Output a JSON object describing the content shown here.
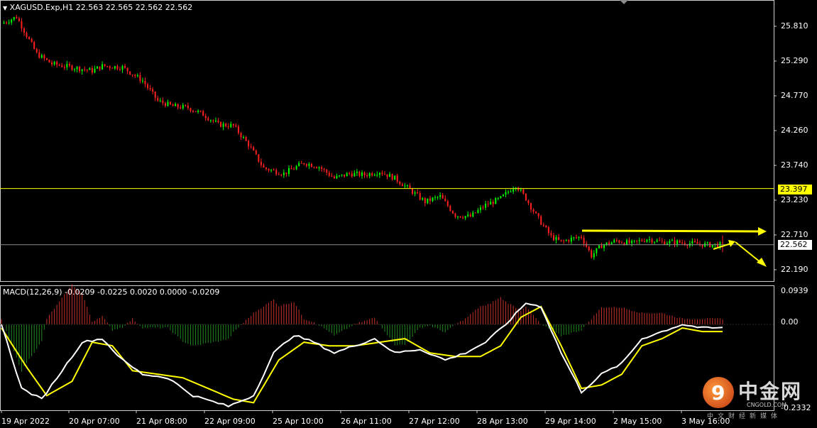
{
  "header": {
    "symbol_line": "XAGUSD.Exp,H1  22.563 22.565 22.562 22.562"
  },
  "macd": {
    "title": "MACD(12,26,9) -0.0209 -0.0225 0.0020 0.0000 -0.0209"
  },
  "price_axis": [
    "25.810",
    "25.290",
    "24.770",
    "24.260",
    "23.740",
    "23.230",
    "22.710",
    "22.190"
  ],
  "price_tags": {
    "resistance": "23.397",
    "current": "22.562"
  },
  "macd_axis": {
    "top": "0.0939",
    "zero": "0.00",
    "bottom": "-0.2332"
  },
  "time_axis": [
    "19 Apr 2022",
    "20 Apr 07:00",
    "21 Apr 08:00",
    "22 Apr 09:00",
    "25 Apr 10:00",
    "26 Apr 11:00",
    "27 Apr 12:00",
    "28 Apr 13:00",
    "29 Apr 14:00",
    "2 May 15:00",
    "3 May 16:00"
  ],
  "logo": {
    "mark": "9",
    "text": "中金网",
    "sub": "CNGOLD.COM",
    "cn": "中文财经新媒体"
  },
  "colors": {
    "bull": "#00ff00",
    "bear": "#ff2020",
    "macd_line": "#ffffff",
    "signal": "#ffff00",
    "resistance": "#ffff00",
    "hist_pos": "#c8312b",
    "hist_neg": "#1f8a1f"
  },
  "chart_data": {
    "type": "candlestick",
    "symbol": "XAGUSD.Exp",
    "timeframe": "H1",
    "ohlc_last": {
      "open": 22.563,
      "high": 22.565,
      "low": 22.562,
      "close": 22.562
    },
    "horizontal_lines": [
      23.397,
      22.562
    ],
    "close_path": [
      [
        0,
        25.85
      ],
      [
        6,
        25.95
      ],
      [
        14,
        25.4
      ],
      [
        20,
        25.25
      ],
      [
        28,
        25.2
      ],
      [
        36,
        25.15
      ],
      [
        40,
        25.22
      ],
      [
        48,
        25.2
      ],
      [
        56,
        25.0
      ],
      [
        62,
        24.7
      ],
      [
        68,
        24.62
      ],
      [
        74,
        24.6
      ],
      [
        80,
        24.5
      ],
      [
        86,
        24.35
      ],
      [
        92,
        24.33
      ],
      [
        98,
        24.05
      ],
      [
        104,
        23.7
      ],
      [
        112,
        23.62
      ],
      [
        120,
        23.78
      ],
      [
        126,
        23.72
      ],
      [
        132,
        23.55
      ],
      [
        138,
        23.62
      ],
      [
        144,
        23.6
      ],
      [
        150,
        23.65
      ],
      [
        156,
        23.55
      ],
      [
        162,
        23.38
      ],
      [
        168,
        23.2
      ],
      [
        174,
        23.28
      ],
      [
        180,
        23.0
      ],
      [
        186,
        22.98
      ],
      [
        192,
        23.15
      ],
      [
        198,
        23.25
      ],
      [
        204,
        23.45
      ],
      [
        208,
        23.25
      ],
      [
        212,
        23.0
      ],
      [
        218,
        22.68
      ],
      [
        222,
        22.6
      ],
      [
        226,
        22.65
      ],
      [
        230,
        22.68
      ],
      [
        234,
        22.4
      ],
      [
        238,
        22.55
      ],
      [
        244,
        22.62
      ],
      [
        250,
        22.58
      ],
      [
        256,
        22.65
      ],
      [
        262,
        22.6
      ],
      [
        268,
        22.6
      ],
      [
        274,
        22.58
      ],
      [
        280,
        22.56
      ],
      [
        286,
        22.56
      ]
    ],
    "macd": [
      [
        0,
        0.0
      ],
      [
        8,
        -0.18
      ],
      [
        16,
        -0.21
      ],
      [
        24,
        -0.13
      ],
      [
        32,
        -0.05
      ],
      [
        40,
        -0.04
      ],
      [
        48,
        -0.1
      ],
      [
        56,
        -0.14
      ],
      [
        66,
        -0.15
      ],
      [
        76,
        -0.2
      ],
      [
        90,
        -0.23
      ],
      [
        100,
        -0.2
      ],
      [
        108,
        -0.08
      ],
      [
        116,
        -0.03
      ],
      [
        124,
        -0.05
      ],
      [
        132,
        -0.08
      ],
      [
        140,
        -0.06
      ],
      [
        148,
        -0.04
      ],
      [
        156,
        -0.08
      ],
      [
        166,
        -0.07
      ],
      [
        176,
        -0.1
      ],
      [
        184,
        -0.08
      ],
      [
        192,
        -0.05
      ],
      [
        200,
        0.0
      ],
      [
        208,
        0.06
      ],
      [
        214,
        0.05
      ],
      [
        222,
        -0.08
      ],
      [
        230,
        -0.19
      ],
      [
        238,
        -0.14
      ],
      [
        246,
        -0.11
      ],
      [
        254,
        -0.04
      ],
      [
        262,
        -0.02
      ],
      [
        270,
        0.0
      ],
      [
        278,
        -0.01
      ],
      [
        286,
        -0.01
      ]
    ],
    "signal": [
      [
        0,
        -0.01
      ],
      [
        10,
        -0.12
      ],
      [
        18,
        -0.2
      ],
      [
        28,
        -0.16
      ],
      [
        36,
        -0.05
      ],
      [
        44,
        -0.06
      ],
      [
        52,
        -0.13
      ],
      [
        62,
        -0.14
      ],
      [
        72,
        -0.15
      ],
      [
        82,
        -0.18
      ],
      [
        92,
        -0.21
      ],
      [
        100,
        -0.22
      ],
      [
        110,
        -0.1
      ],
      [
        120,
        -0.05
      ],
      [
        130,
        -0.06
      ],
      [
        140,
        -0.06
      ],
      [
        150,
        -0.05
      ],
      [
        160,
        -0.04
      ],
      [
        170,
        -0.08
      ],
      [
        180,
        -0.09
      ],
      [
        190,
        -0.09
      ],
      [
        198,
        -0.06
      ],
      [
        206,
        0.02
      ],
      [
        214,
        0.05
      ],
      [
        222,
        -0.06
      ],
      [
        230,
        -0.18
      ],
      [
        238,
        -0.17
      ],
      [
        246,
        -0.14
      ],
      [
        254,
        -0.06
      ],
      [
        262,
        -0.04
      ],
      [
        270,
        -0.01
      ],
      [
        278,
        -0.02
      ],
      [
        286,
        -0.02
      ]
    ]
  }
}
